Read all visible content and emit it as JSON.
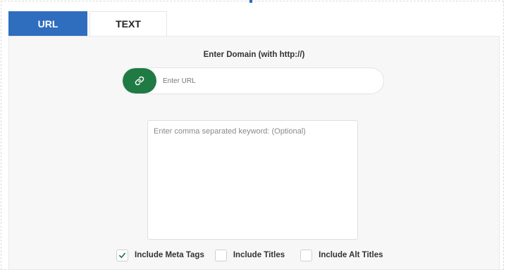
{
  "tabs": [
    {
      "label": "URL",
      "active": true
    },
    {
      "label": "TEXT",
      "active": false
    }
  ],
  "form": {
    "domain_label": "Enter Domain (with http://)",
    "url_placeholder": "Enter URL",
    "url_value": "",
    "keyword_placeholder": "Enter comma separated keyword: (Optional)",
    "keyword_value": ""
  },
  "options": [
    {
      "label": "Include Meta Tags",
      "checked": true
    },
    {
      "label": "Include Titles",
      "checked": false
    },
    {
      "label": "Include Alt Titles",
      "checked": false
    }
  ],
  "icons": {
    "url_field": "link-icon",
    "checked": "check-icon"
  },
  "colors": {
    "tab_active": "#2f6dbf",
    "url_icon_bg": "#1f7a43",
    "check": "#1f7a43",
    "panel_bg": "#f7f7f7"
  }
}
